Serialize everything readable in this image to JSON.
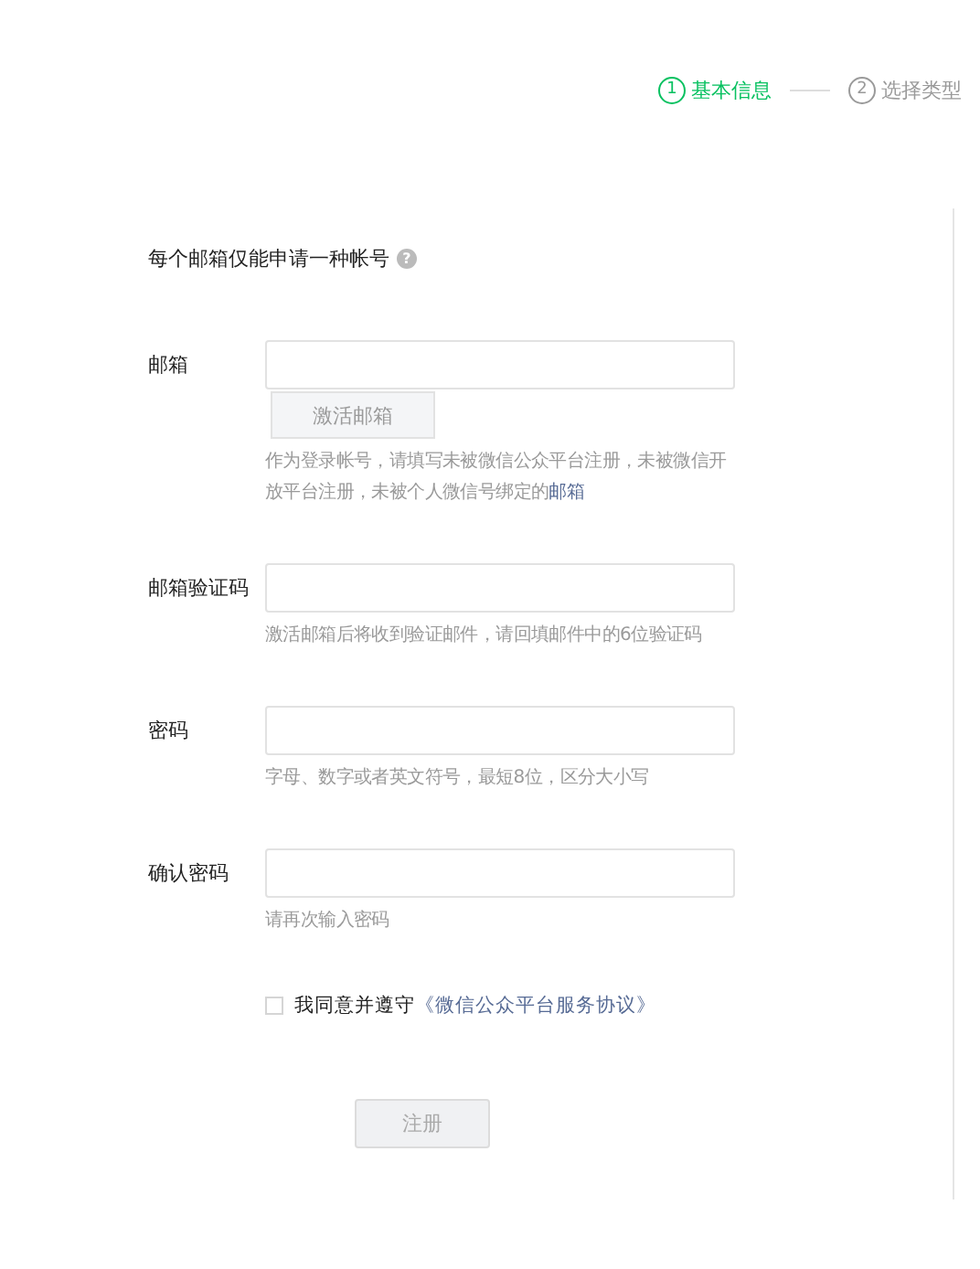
{
  "steps": [
    {
      "number": "1",
      "label": "基本信息",
      "selected": true
    },
    {
      "number": "2",
      "label": "选择类型",
      "selected": false
    }
  ],
  "notice": {
    "text": "每个邮箱仅能申请一种帐号",
    "help_icon": "?"
  },
  "fields": [
    {
      "label": "邮箱",
      "button": "激活邮箱",
      "hint": "作为登录帐号，请填写未被微信公众平台注册，未被微信开放平台注册，未被个人微信号绑定的",
      "hint_link": "邮箱"
    },
    {
      "label": "邮箱验证码",
      "hint": "激活邮箱后将收到验证邮件，请回填邮件中的6位验证码"
    },
    {
      "label": "密码",
      "hint": "字母、数字或者英文符号，最短8位，区分大小写"
    },
    {
      "label": "确认密码",
      "hint": "请再次输入密码"
    }
  ],
  "agreement": {
    "checked": false,
    "text": "我同意并遵守",
    "link": "《微信公众平台服务协议》"
  },
  "submit": {
    "label": "注册",
    "disabled": true
  }
}
